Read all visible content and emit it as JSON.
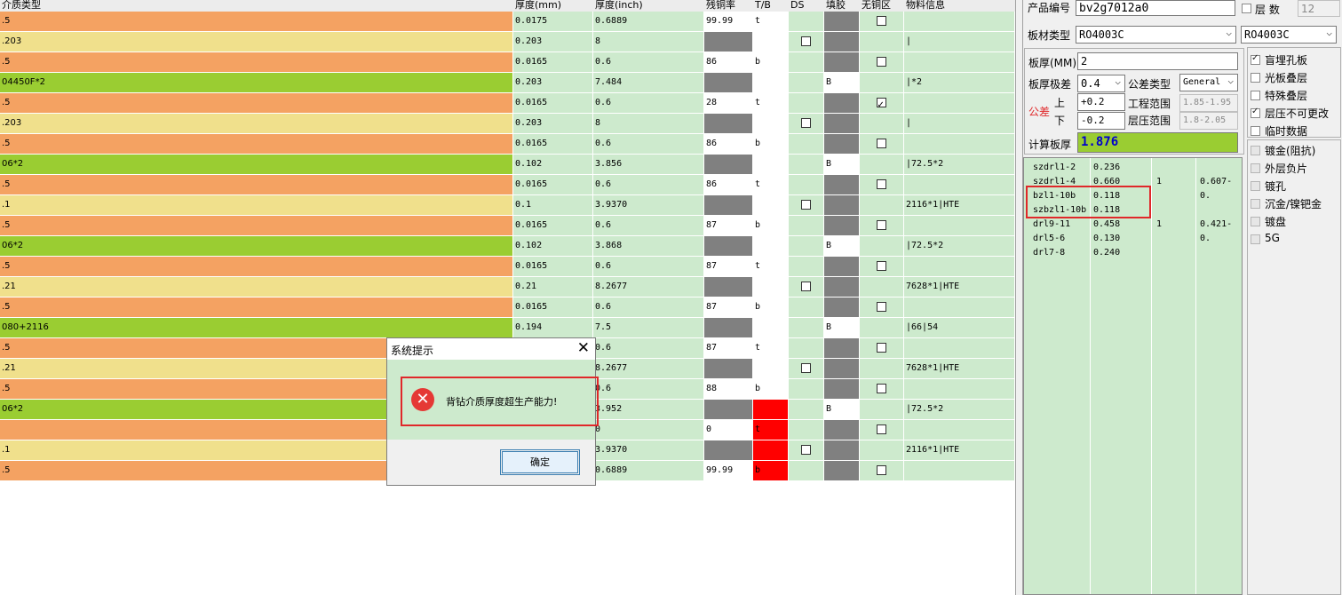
{
  "colors": {
    "copper": "#f4a262",
    "core": "#f0e08c",
    "prepreg": "#9acd32",
    "panel_green": "#cdeacd",
    "error": "#e53935",
    "highlight": "#e0282a"
  },
  "grid": {
    "headers": {
      "type": "介质类型",
      "mm": "厚度(mm)",
      "inch": "厚度(inch)",
      "copper_rate": "残铜率",
      "tb": "T/B",
      "ds": "DS",
      "fill": "填胶",
      "no_copper": "无铜区",
      "material": "物料信息"
    },
    "rows": [
      {
        "kind": "copper",
        "type": ".5",
        "mm": "0.0175",
        "inch": "0.6889",
        "cu": "99.99",
        "tb": "t",
        "ds": null,
        "fill": "",
        "nocu": false,
        "mat": ""
      },
      {
        "kind": "core",
        "type": ".203",
        "mm": "0.203",
        "inch": "8",
        "cu": "",
        "tb": "",
        "ds": false,
        "fill": "",
        "nocu": null,
        "mat": "|"
      },
      {
        "kind": "copper",
        "type": ".5",
        "mm": "0.0165",
        "inch": "0.6",
        "cu": "86",
        "tb": "b",
        "ds": null,
        "fill": "",
        "nocu": false,
        "mat": ""
      },
      {
        "kind": "pp",
        "type": "04450F*2",
        "mm": "0.203",
        "inch": "7.484",
        "cu": "",
        "tb": "",
        "ds": null,
        "fill": "B",
        "nocu": null,
        "mat": "|*2"
      },
      {
        "kind": "copper",
        "type": ".5",
        "mm": "0.0165",
        "inch": "0.6",
        "cu": "28",
        "tb": "t",
        "ds": null,
        "fill": "",
        "nocu": true,
        "mat": ""
      },
      {
        "kind": "core",
        "type": ".203",
        "mm": "0.203",
        "inch": "8",
        "cu": "",
        "tb": "",
        "ds": false,
        "fill": "",
        "nocu": null,
        "mat": "|"
      },
      {
        "kind": "copper",
        "type": ".5",
        "mm": "0.0165",
        "inch": "0.6",
        "cu": "86",
        "tb": "b",
        "ds": null,
        "fill": "",
        "nocu": false,
        "mat": ""
      },
      {
        "kind": "pp",
        "type": "06*2",
        "mm": "0.102",
        "inch": "3.856",
        "cu": "",
        "tb": "",
        "ds": null,
        "fill": "B",
        "nocu": null,
        "mat": "|72.5*2"
      },
      {
        "kind": "copper",
        "type": ".5",
        "mm": "0.0165",
        "inch": "0.6",
        "cu": "86",
        "tb": "t",
        "ds": null,
        "fill": "",
        "nocu": false,
        "mat": ""
      },
      {
        "kind": "core",
        "type": ".1",
        "mm": "0.1",
        "inch": "3.9370",
        "cu": "",
        "tb": "",
        "ds": false,
        "fill": "",
        "nocu": null,
        "mat": "2116*1|HTE"
      },
      {
        "kind": "copper",
        "type": ".5",
        "mm": "0.0165",
        "inch": "0.6",
        "cu": "87",
        "tb": "b",
        "ds": null,
        "fill": "",
        "nocu": false,
        "mat": ""
      },
      {
        "kind": "pp",
        "type": "06*2",
        "mm": "0.102",
        "inch": "3.868",
        "cu": "",
        "tb": "",
        "ds": null,
        "fill": "B",
        "nocu": null,
        "mat": "|72.5*2"
      },
      {
        "kind": "copper",
        "type": ".5",
        "mm": "0.0165",
        "inch": "0.6",
        "cu": "87",
        "tb": "t",
        "ds": null,
        "fill": "",
        "nocu": false,
        "mat": ""
      },
      {
        "kind": "core",
        "type": ".21",
        "mm": "0.21",
        "inch": "8.2677",
        "cu": "",
        "tb": "",
        "ds": false,
        "fill": "",
        "nocu": null,
        "mat": "7628*1|HTE"
      },
      {
        "kind": "copper",
        "type": ".5",
        "mm": "0.0165",
        "inch": "0.6",
        "cu": "87",
        "tb": "b",
        "ds": null,
        "fill": "",
        "nocu": false,
        "mat": ""
      },
      {
        "kind": "pp",
        "type": "080+2116",
        "mm": "0.194",
        "inch": "7.5",
        "cu": "",
        "tb": "",
        "ds": null,
        "fill": "B",
        "nocu": null,
        "mat": "|66|54"
      },
      {
        "kind": "copper",
        "type": ".5",
        "mm": "",
        "inch": "0.6",
        "cu": "87",
        "tb": "t",
        "ds": null,
        "fill": "",
        "nocu": false,
        "mat": ""
      },
      {
        "kind": "core",
        "type": ".21",
        "mm": "",
        "inch": "8.2677",
        "cu": "",
        "tb": "",
        "ds": false,
        "fill": "",
        "nocu": null,
        "mat": "7628*1|HTE"
      },
      {
        "kind": "copper",
        "type": ".5",
        "mm": "",
        "inch": "0.6",
        "cu": "88",
        "tb": "b",
        "ds": null,
        "fill": "",
        "nocu": false,
        "mat": ""
      },
      {
        "kind": "pp",
        "type": "06*2",
        "mm": "",
        "inch": "3.952",
        "cu": "",
        "tb": "",
        "ds": null,
        "fill": "B",
        "nocu": null,
        "mat": "|72.5*2",
        "tbred": true
      },
      {
        "kind": "copper",
        "type": "",
        "mm": "",
        "inch": "0",
        "cu": "0",
        "tb": "t",
        "ds": null,
        "fill": "",
        "nocu": false,
        "mat": "",
        "tbred": true
      },
      {
        "kind": "core",
        "type": ".1",
        "mm": "",
        "inch": "3.9370",
        "cu": "",
        "tb": "",
        "ds": false,
        "fill": "",
        "nocu": null,
        "mat": "2116*1|HTE",
        "tbred": true
      },
      {
        "kind": "copper",
        "type": ".5",
        "mm": "",
        "inch": "0.6889",
        "cu": "99.99",
        "tb": "b",
        "ds": null,
        "fill": "",
        "nocu": false,
        "mat": "",
        "tbred": true
      }
    ]
  },
  "panel": {
    "product_no_label": "产品编号",
    "product_no": "bv2g7012a0",
    "layers_label": "层 数",
    "layers": "12",
    "board_type_label": "板材类型",
    "board_type_1": "RO4003C",
    "board_type_2": "RO4003C",
    "thickness_label": "板厚(MM)",
    "thickness": "2",
    "thick_tol_label": "板厚极差",
    "thick_tol": "0.4",
    "tol_type_label": "公差类型",
    "tol_type": "General",
    "tolerance_label": "公差",
    "upper_label": "上",
    "lower_label": "下",
    "upper": "+0.2",
    "lower": "-0.2",
    "eng_range_label": "工程范围",
    "eng_range": "1.85-1.95",
    "press_range_label": "层压范围",
    "press_range": "1.8-2.05",
    "calc_label": "计算板厚",
    "calc": "1.876",
    "options": [
      {
        "label": "盲埋孔板",
        "checked": true,
        "enabled": true
      },
      {
        "label": "光板叠层",
        "checked": false,
        "enabled": true
      },
      {
        "label": "特殊叠层",
        "checked": false,
        "enabled": true
      },
      {
        "label": "层压不可更改",
        "checked": true,
        "enabled": true
      },
      {
        "label": "临时数据",
        "checked": false,
        "enabled": true
      },
      {
        "label": "镀金(阻抗)",
        "checked": false,
        "enabled": false
      },
      {
        "label": "外层负片",
        "checked": false,
        "enabled": false
      },
      {
        "label": "镀孔",
        "checked": false,
        "enabled": false
      },
      {
        "label": "沉金/镍钯金",
        "checked": false,
        "enabled": false
      },
      {
        "label": "镀盘",
        "checked": false,
        "enabled": false
      },
      {
        "label": "5G",
        "checked": false,
        "enabled": false
      }
    ],
    "drills": [
      {
        "name": "szdrl1-2",
        "v": "0.236",
        "n": "",
        "w": ""
      },
      {
        "name": "szdrl1-4",
        "v": "0.660",
        "n": "1",
        "w": "0.607-0."
      },
      {
        "name": "bzl1-10b",
        "v": "0.118",
        "n": "",
        "w": ""
      },
      {
        "name": "szbzl1-10b",
        "v": "0.118",
        "n": "",
        "w": ""
      },
      {
        "name": "drl9-11",
        "v": "0.458",
        "n": "1",
        "w": "0.421-0."
      },
      {
        "name": "drl5-6",
        "v": "0.130",
        "n": "",
        "w": ""
      },
      {
        "name": "drl7-8",
        "v": "0.240",
        "n": "",
        "w": ""
      }
    ]
  },
  "dialog": {
    "title": "系统提示",
    "message": "背钻介质厚度超生产能力!",
    "ok": "确定",
    "close_icon": "close-icon",
    "error_icon": "error-icon"
  }
}
